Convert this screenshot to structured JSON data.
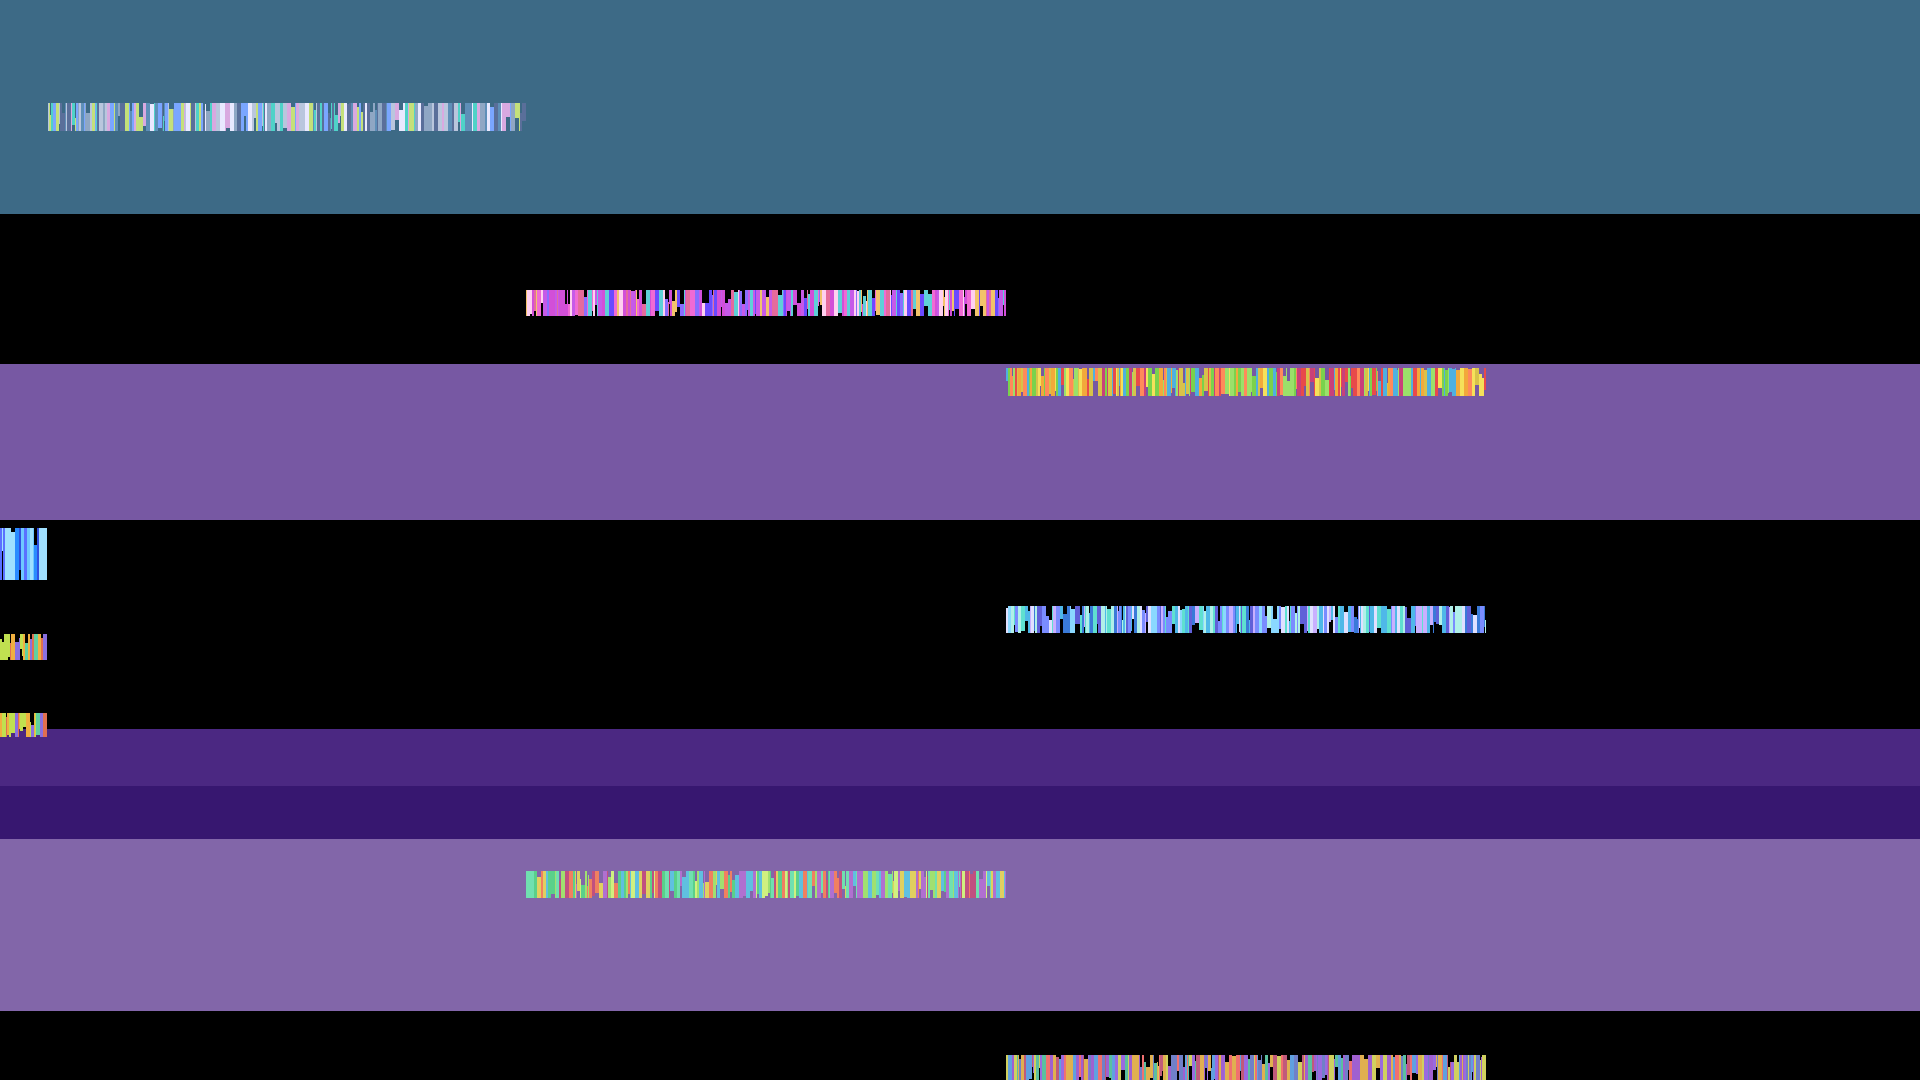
{
  "colors": {
    "background": "#000000",
    "band_teal": "#3d6a86",
    "band_violet": "#7758a3",
    "band_deep_purple": "#4b2882",
    "band_darker_purple": "#371770",
    "band_lavender": "#8266a9"
  },
  "glitch_palettes": {
    "header": [
      "#8fa7c4",
      "#5e8fb8",
      "#b9c6dd",
      "#4fd2c8",
      "#d9a9e0",
      "#7aa6ff",
      "#c4e07a",
      "#e9e9ff",
      "#5a6f9a"
    ],
    "magenta": [
      "#d24fd8",
      "#8a6dff",
      "#e56b9c",
      "#f2c36b",
      "#5fd0d7",
      "#c65ae8",
      "#ffd0f0",
      "#6a4aff",
      "#f06ad4"
    ],
    "warm": [
      "#e84a4a",
      "#f2a93b",
      "#7ad24c",
      "#f5e15a",
      "#c9407a",
      "#4fb0e0",
      "#ff8a5a",
      "#9be06a",
      "#d8c24a"
    ],
    "cool": [
      "#4fb8e8",
      "#7a8cff",
      "#5fe0d0",
      "#c9b0ff",
      "#3a7ad8",
      "#e0e0ff",
      "#8ad8ff",
      "#6060d8",
      "#b0f0e8"
    ],
    "small_blue": [
      "#2a8cff",
      "#6ec8ff",
      "#3050e0",
      "#a0e0ff",
      "#5a70ff"
    ],
    "small_warm": [
      "#c0e050",
      "#f0b040",
      "#8a70e0",
      "#e07050",
      "#60d0a0"
    ],
    "green": [
      "#5ad08a",
      "#a0e070",
      "#c05080",
      "#60c0e0",
      "#e0d060",
      "#f08060",
      "#70e0b0",
      "#b070d0",
      "#d0f080"
    ],
    "mixed": [
      "#7080c8",
      "#c05a7a",
      "#e0b050",
      "#5ac0a0",
      "#a060d0",
      "#f07070",
      "#60a0e0",
      "#d0d060",
      "#9a6ae0"
    ]
  }
}
